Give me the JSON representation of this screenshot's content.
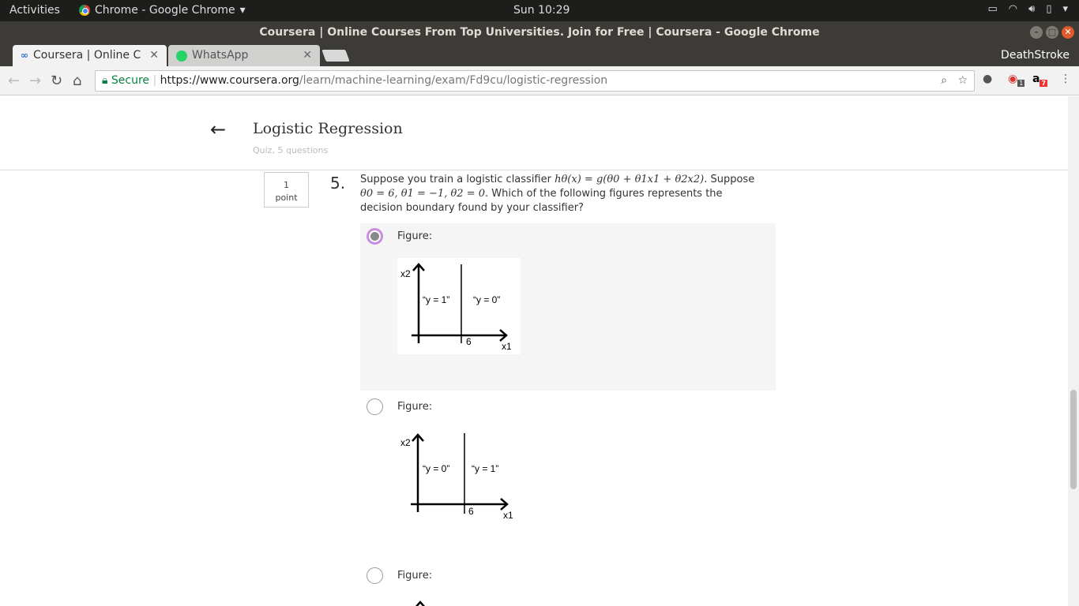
{
  "os": {
    "activities": "Activities",
    "app_name": "Chrome - Google Chrome",
    "clock": "Sun 10:29"
  },
  "window": {
    "title": "Coursera | Online Courses From Top Universities. Join for Free | Coursera - Google Chrome"
  },
  "tabs": [
    {
      "label": "Coursera | Online C",
      "active": true
    },
    {
      "label": "WhatsApp",
      "active": false
    }
  ],
  "profile_name": "DeathStroke",
  "omnibox": {
    "secure_label": "Secure",
    "url_scheme_host": "https://www.coursera.org",
    "url_path": "/learn/machine-learning/exam/Fd9cu/logistic-regression"
  },
  "extensions": {
    "badge1": "1",
    "badge2": "7"
  },
  "quiz": {
    "title": "Logistic Regression",
    "subtitle": "Quiz, 5 questions"
  },
  "question": {
    "points_num": "1",
    "points_label": "point",
    "number": "5.",
    "text_prefix": "Suppose you train a logistic classifier ",
    "text_math1": "hθ(x) = g(θ0 + θ1x1 + θ2x2)",
    "text_mid": ". Suppose",
    "text_math2": "θ0 = 6, θ1 = −1, θ2 = 0",
    "text_suffix": ". Which of the following figures represents the decision boundary found by your classifier?"
  },
  "options": [
    {
      "label": "Figure:",
      "selected": true,
      "left_region": "“y = 1”",
      "right_region": "“y = 0”",
      "tick": "6",
      "x_axis": "x1",
      "y_axis": "x2"
    },
    {
      "label": "Figure:",
      "selected": false,
      "left_region": "“y = 0”",
      "right_region": "“y = 1”",
      "tick": "6",
      "x_axis": "x1",
      "y_axis": "x2"
    },
    {
      "label": "Figure:",
      "selected": false
    }
  ]
}
